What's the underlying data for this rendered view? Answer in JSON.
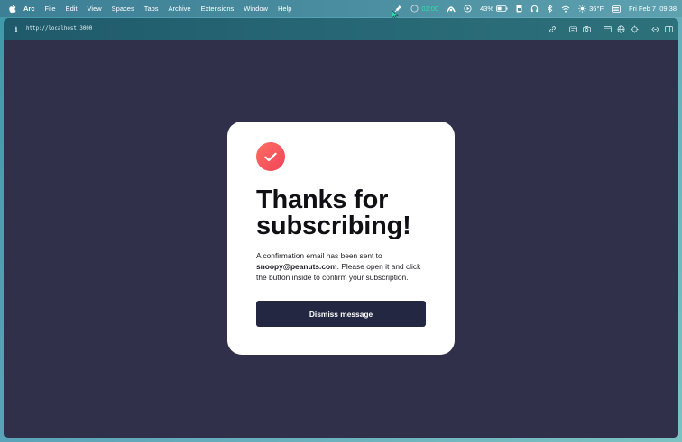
{
  "menubar": {
    "app_name": "Arc",
    "items": [
      "File",
      "Edit",
      "View",
      "Spaces",
      "Tabs",
      "Archive",
      "Extensions",
      "Window",
      "Help"
    ],
    "timer": "02:00",
    "battery": "43%",
    "weather": "36°F",
    "datetime": "Fri Feb 7  09:38",
    "accent_timer": "#2fe0a4"
  },
  "browser": {
    "url": "http://localhost:3000",
    "info_icon": "i"
  },
  "card": {
    "title": "Thanks for subscribing!",
    "message_before": "A confirmation email has been sent to ",
    "email": "snoopy@peanuts.com",
    "message_after": ". Please open it and click the button inside to confirm your subscription.",
    "dismiss_label": "Dismiss message",
    "badge_colors": [
      "#ff6f61",
      "#f0435a"
    ],
    "button_color": "#242741"
  }
}
